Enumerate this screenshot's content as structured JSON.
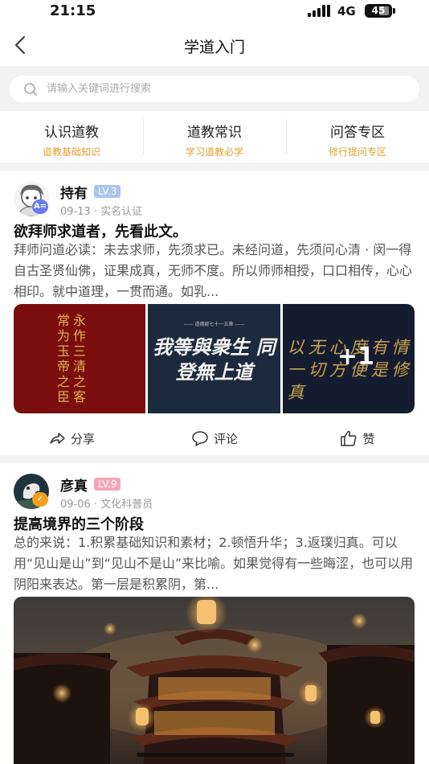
{
  "status": {
    "time": "21:15",
    "network": "4G",
    "battery": "45"
  },
  "nav": {
    "title": "学道入门"
  },
  "search": {
    "placeholder": "请输入关键词进行搜索"
  },
  "tabs": [
    {
      "title": "认识道教",
      "subtitle": "道教基础知识"
    },
    {
      "title": "道教常识",
      "subtitle": "学习道教必学"
    },
    {
      "title": "问答专区",
      "subtitle": "修行提问专区"
    }
  ],
  "posts": [
    {
      "author": "持有",
      "level": "LV.3",
      "meta": "09-13 · 实名认证",
      "title": "欲拜师求道者，先看此文。",
      "body": "拜师问道必读：未去求师，先须求已。未经问道，先须问心清 · 闵一得自古圣贤仙佛，证果成真，无师不度。所以师师相授，口口相传，心心相印。就中道理，一贯而通。如乳...",
      "image_texts": [
        "永作三清之客 常为玉帝之臣",
        "我等與衆生 同登無上道",
        "以无心度有情 一切方便是修真"
      ],
      "image_small": "—— 道德經七十一五章 ——",
      "more_count": "+1",
      "actions": [
        "分享",
        "评论",
        "赞"
      ]
    },
    {
      "author": "彦真",
      "level": "LV.9",
      "meta": "09-06 · 文化科普员",
      "title": "提高境界的三个阶段",
      "body": "总的来说：1.积累基础知识和素材；2.顿悟升华；3.返璞归真。可以用“见山是山”到“见山不是山”来比喻。如果觉得有一些晦涩，也可以用阴阳来表达。第一层是积累阴，第..."
    }
  ],
  "colors": {
    "accent": "#e0a030",
    "lv3": "#a9c4ef",
    "lv9": "#f4a6b8"
  }
}
